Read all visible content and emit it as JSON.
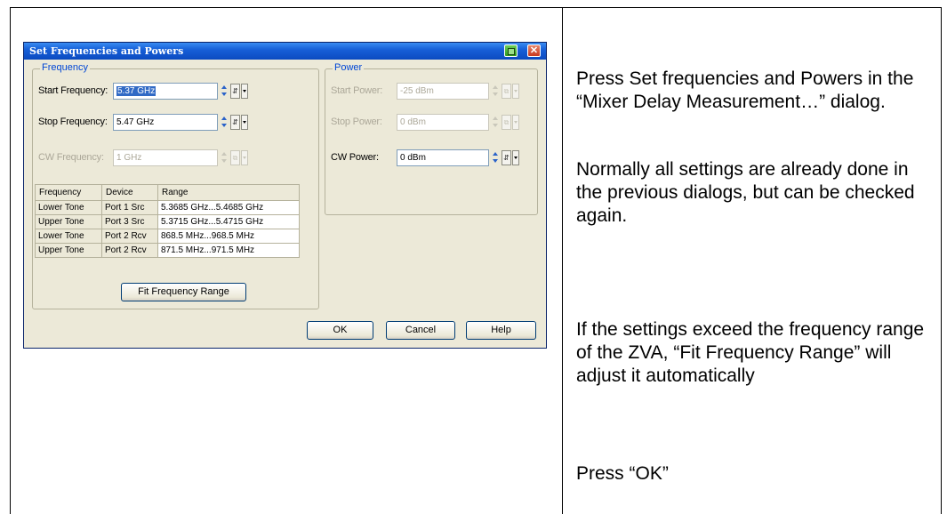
{
  "dialog": {
    "title": "Set Frequencies and Powers",
    "frequency_group": "Frequency",
    "power_group": "Power",
    "start_frequency": {
      "label": "Start Frequency:",
      "value": "5.37 GHz"
    },
    "stop_frequency": {
      "label": "Stop Frequency:",
      "value": "5.47 GHz"
    },
    "cw_frequency": {
      "label": "CW Frequency:",
      "value": "1 GHz"
    },
    "start_power": {
      "label": "Start Power:",
      "value": "-25 dBm"
    },
    "stop_power": {
      "label": "Stop Power:",
      "value": "0 dBm"
    },
    "cw_power": {
      "label": "CW Power:",
      "value": "0 dBm"
    },
    "table": {
      "headers": [
        "Frequency",
        "Device",
        "Range"
      ],
      "rows": [
        [
          "Lower Tone",
          "Port 1 Src",
          "5.3685 GHz...5.4685 GHz"
        ],
        [
          "Upper Tone",
          "Port 3 Src",
          "5.3715 GHz...5.4715 GHz"
        ],
        [
          "Lower Tone",
          "Port 2 Rcv",
          "868.5 MHz...968.5 MHz"
        ],
        [
          "Upper Tone",
          "Port 2 Rcv",
          "871.5 MHz...971.5 MHz"
        ]
      ]
    },
    "fit_button": "Fit Frequency Range",
    "ok_button": "OK",
    "cancel_button": "Cancel",
    "help_button": "Help",
    "close_glyph": "✕"
  },
  "instructions": {
    "p1": "Press Set frequencies and Powers in the “Mixer Delay Measurement…” dialog.",
    "p2": "Normally all settings are already done in the previous dialogs, but can be checked again.",
    "p3": "If the settings exceed the frequency range of the ZVA, “Fit Frequency Range” will adjust it automatically",
    "p4": "Press “OK”"
  },
  "colors": {
    "title_bar": "#0b4ac0",
    "dialog_bg": "#ece9d8",
    "group_label": "#0046d5",
    "selection": "#316ac5"
  }
}
